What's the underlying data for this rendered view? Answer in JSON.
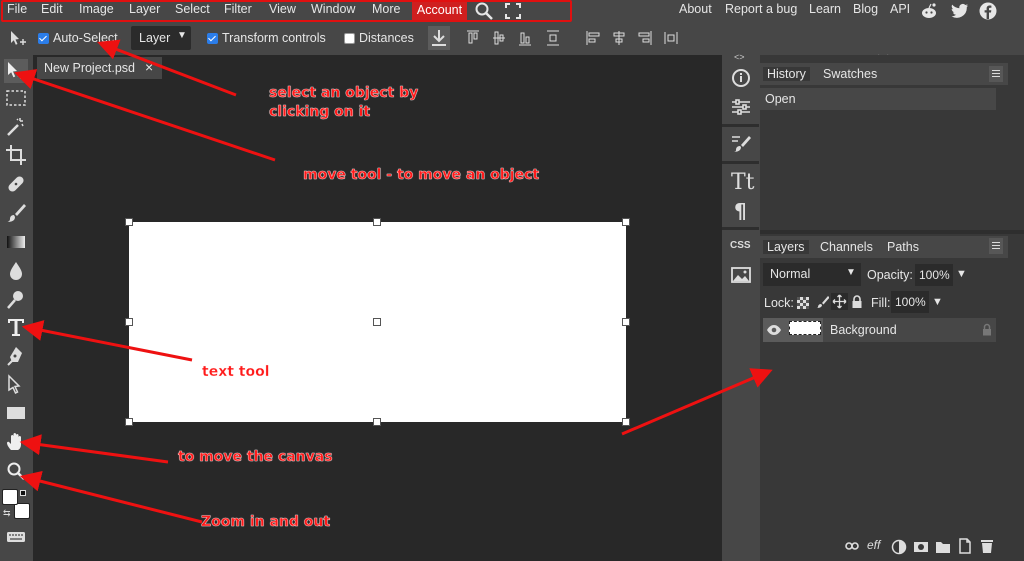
{
  "menu": {
    "items": [
      "File",
      "Edit",
      "Image",
      "Layer",
      "Select",
      "Filter",
      "View",
      "Window",
      "More"
    ],
    "account": "Account",
    "right_links": [
      "About",
      "Report a bug",
      "Learn",
      "Blog",
      "API"
    ],
    "social_icons": [
      "reddit-icon",
      "twitter-icon",
      "facebook-icon"
    ]
  },
  "options": {
    "auto_select": "Auto-Select",
    "layer_select": "Layer",
    "transform_controls": "Transform controls",
    "distances": "Distances"
  },
  "document": {
    "tab_title": "New Project.psd",
    "tab_close": "×"
  },
  "history_panel": {
    "tabs": [
      "History",
      "Swatches"
    ],
    "entries": [
      "Open"
    ]
  },
  "layers_panel": {
    "tabs": [
      "Layers",
      "Channels",
      "Paths"
    ],
    "blend_mode": "Normal",
    "opacity_label": "Opacity:",
    "opacity_value": "100%",
    "lock_label": "Lock:",
    "fill_label": "Fill:",
    "fill_value": "100%",
    "layers": [
      {
        "name": "Background",
        "visible": true,
        "locked": true
      }
    ]
  },
  "mid_column": {
    "css_label": "CSS"
  },
  "annotations": [
    "select an object by\nclicking on it",
    "move tool - to move an object",
    "text tool",
    "to move the canvas",
    "Zoom in and out"
  ],
  "colors": {
    "accent_red": "#e01010",
    "account_bg": "#cf1f1f",
    "checkbox_blue": "#2b7de9"
  }
}
